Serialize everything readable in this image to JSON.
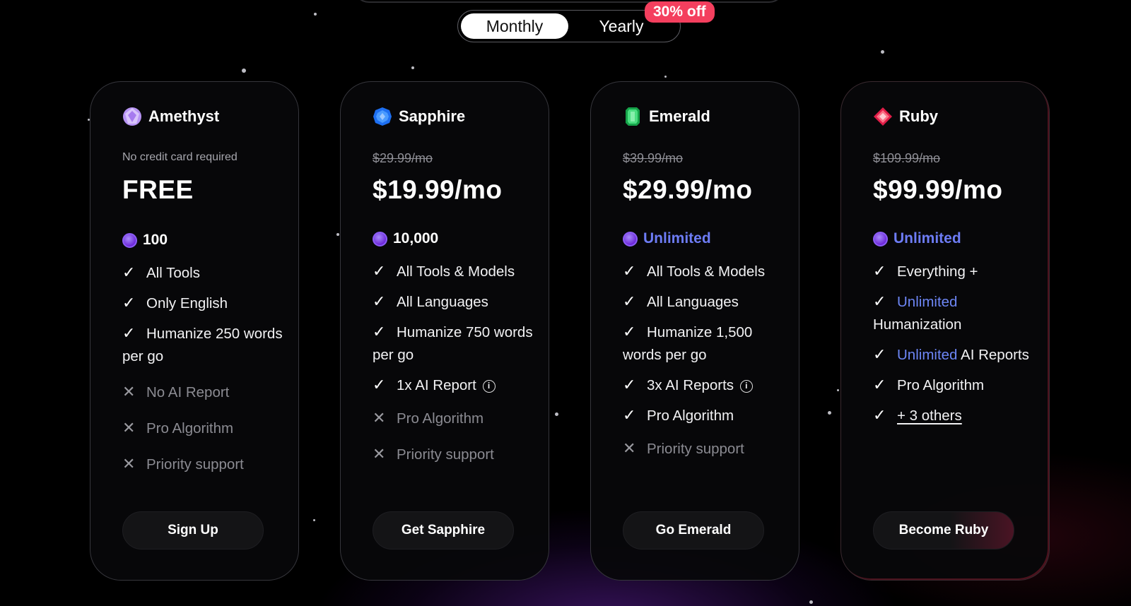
{
  "billing": {
    "options": [
      "Monthly",
      "Yearly"
    ],
    "selected": "Monthly",
    "discount_badge": "30% off"
  },
  "plans": [
    {
      "id": "amethyst",
      "name": "Amethyst",
      "note": "No credit card required",
      "price": "FREE",
      "credits": "100",
      "features": [
        {
          "text": "All Tools",
          "included": true
        },
        {
          "text": "Only English",
          "included": true
        },
        {
          "text": "Humanize 250 words per go",
          "included": true
        },
        {
          "text": "No AI Report",
          "included": false
        },
        {
          "text": "Pro Algorithm",
          "included": false
        },
        {
          "text": "Priority support",
          "included": false
        }
      ],
      "cta": "Sign Up",
      "icon": "amethyst-gem-icon",
      "color": "#c4a6f7"
    },
    {
      "id": "sapphire",
      "name": "Sapphire",
      "old_price": "$29.99/mo",
      "price": "$19.99/mo",
      "credits": "10,000",
      "features": [
        {
          "text": "All Tools & Models",
          "included": true
        },
        {
          "text": "All Languages",
          "included": true
        },
        {
          "text": "Humanize 750 words per go",
          "included": true
        },
        {
          "text": "1x AI Report",
          "included": true,
          "info": true
        },
        {
          "text": "Pro Algorithm",
          "included": false
        },
        {
          "text": "Priority support",
          "included": false
        }
      ],
      "cta": "Get Sapphire",
      "icon": "sapphire-gem-icon",
      "color": "#2f7cf6"
    },
    {
      "id": "emerald",
      "name": "Emerald",
      "old_price": "$39.99/mo",
      "price": "$29.99/mo",
      "credits": "Unlimited",
      "features": [
        {
          "text": "All Tools & Models",
          "included": true
        },
        {
          "text": "All Languages",
          "included": true
        },
        {
          "text": "Humanize 1,500 words per go",
          "included": true
        },
        {
          "text": "3x AI Reports",
          "included": true,
          "info": true
        },
        {
          "text": "Pro Algorithm",
          "included": true
        },
        {
          "text": "Priority support",
          "included": false
        }
      ],
      "cta": "Go Emerald",
      "icon": "emerald-gem-icon",
      "color": "#22c55e"
    },
    {
      "id": "ruby",
      "name": "Ruby",
      "old_price": "$109.99/mo",
      "price": "$99.99/mo",
      "credits": "Unlimited",
      "features": [
        {
          "text": "Everything +",
          "included": true
        },
        {
          "text": "Humanization",
          "included": true,
          "highlight": "Unlimited"
        },
        {
          "text": "AI Reports",
          "included": true,
          "highlight": "Unlimited"
        },
        {
          "text": "Pro Algorithm",
          "included": true
        },
        {
          "text": "+ 3 others",
          "included": true,
          "link": true
        }
      ],
      "cta": "Become Ruby",
      "icon": "ruby-gem-icon",
      "color": "#f43f5e"
    }
  ]
}
